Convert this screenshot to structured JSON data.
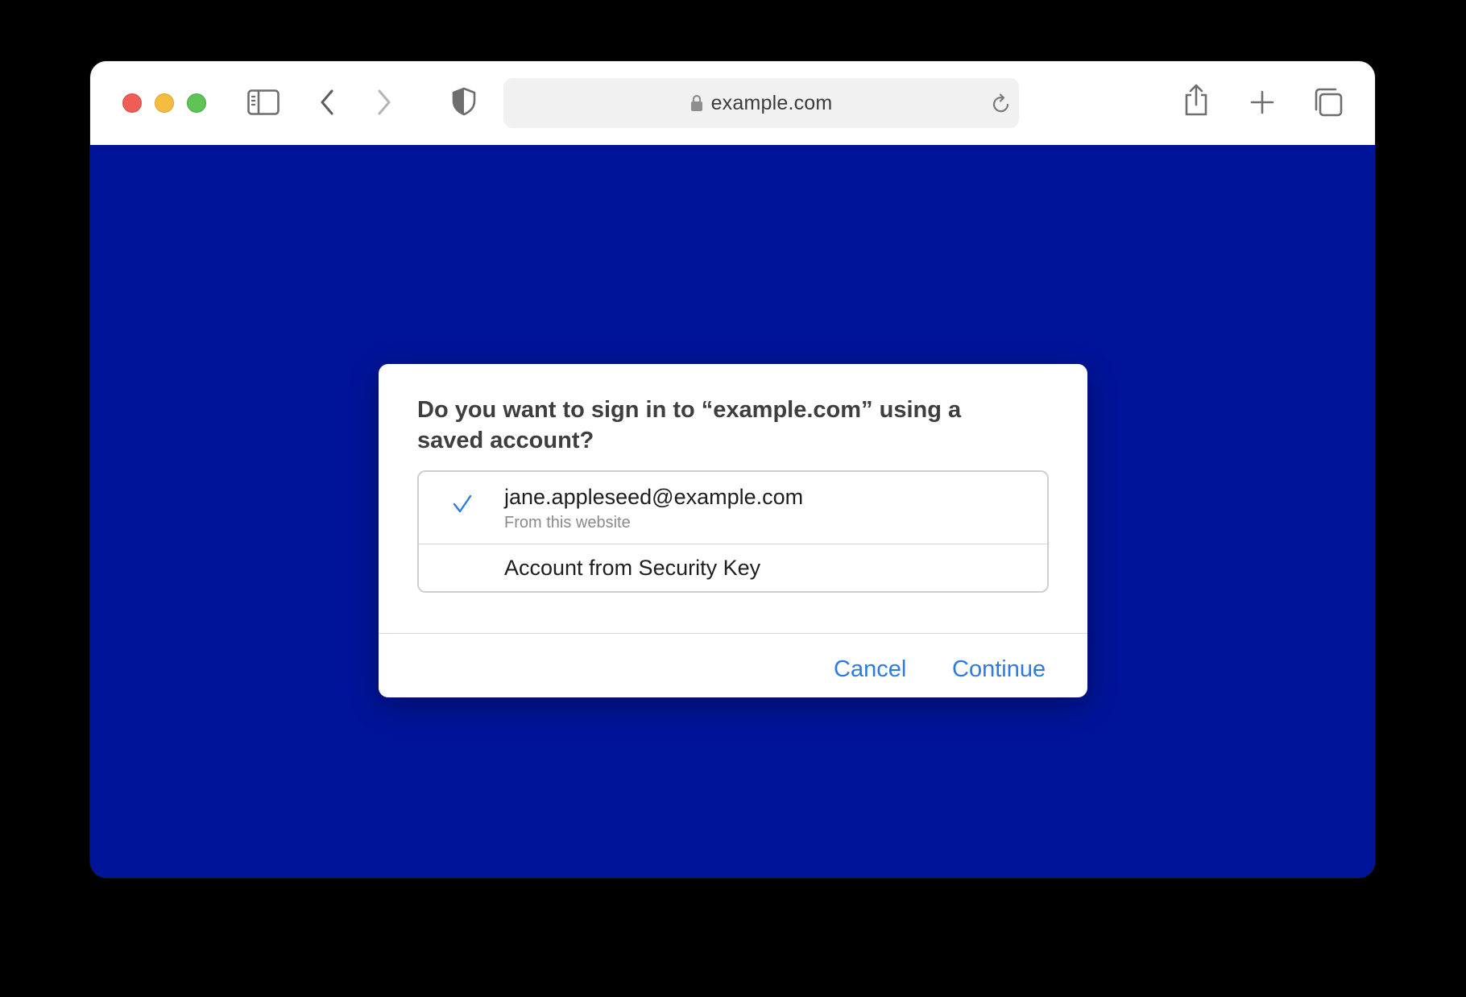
{
  "browser": {
    "address": "example.com",
    "icons": {
      "sidebar": "sidebar-icon",
      "back": "chevron-left-icon",
      "forward": "chevron-right-icon",
      "privacy": "shield-icon",
      "lock": "lock-icon",
      "reload": "reload-icon",
      "share": "share-icon",
      "new_tab": "plus-icon",
      "tabs": "tab-overview-icon"
    }
  },
  "page": {
    "background_color": "#00149a"
  },
  "dialog": {
    "title": "Do you want to sign in to “example.com” using a saved account?",
    "accounts": [
      {
        "name": "jane.appleseed@example.com",
        "subtitle": "From this website",
        "selected": true
      },
      {
        "name": "Account from Security Key",
        "subtitle": "",
        "selected": false
      }
    ],
    "cancel_label": "Cancel",
    "continue_label": "Continue",
    "accent_color": "#2d7be0"
  }
}
